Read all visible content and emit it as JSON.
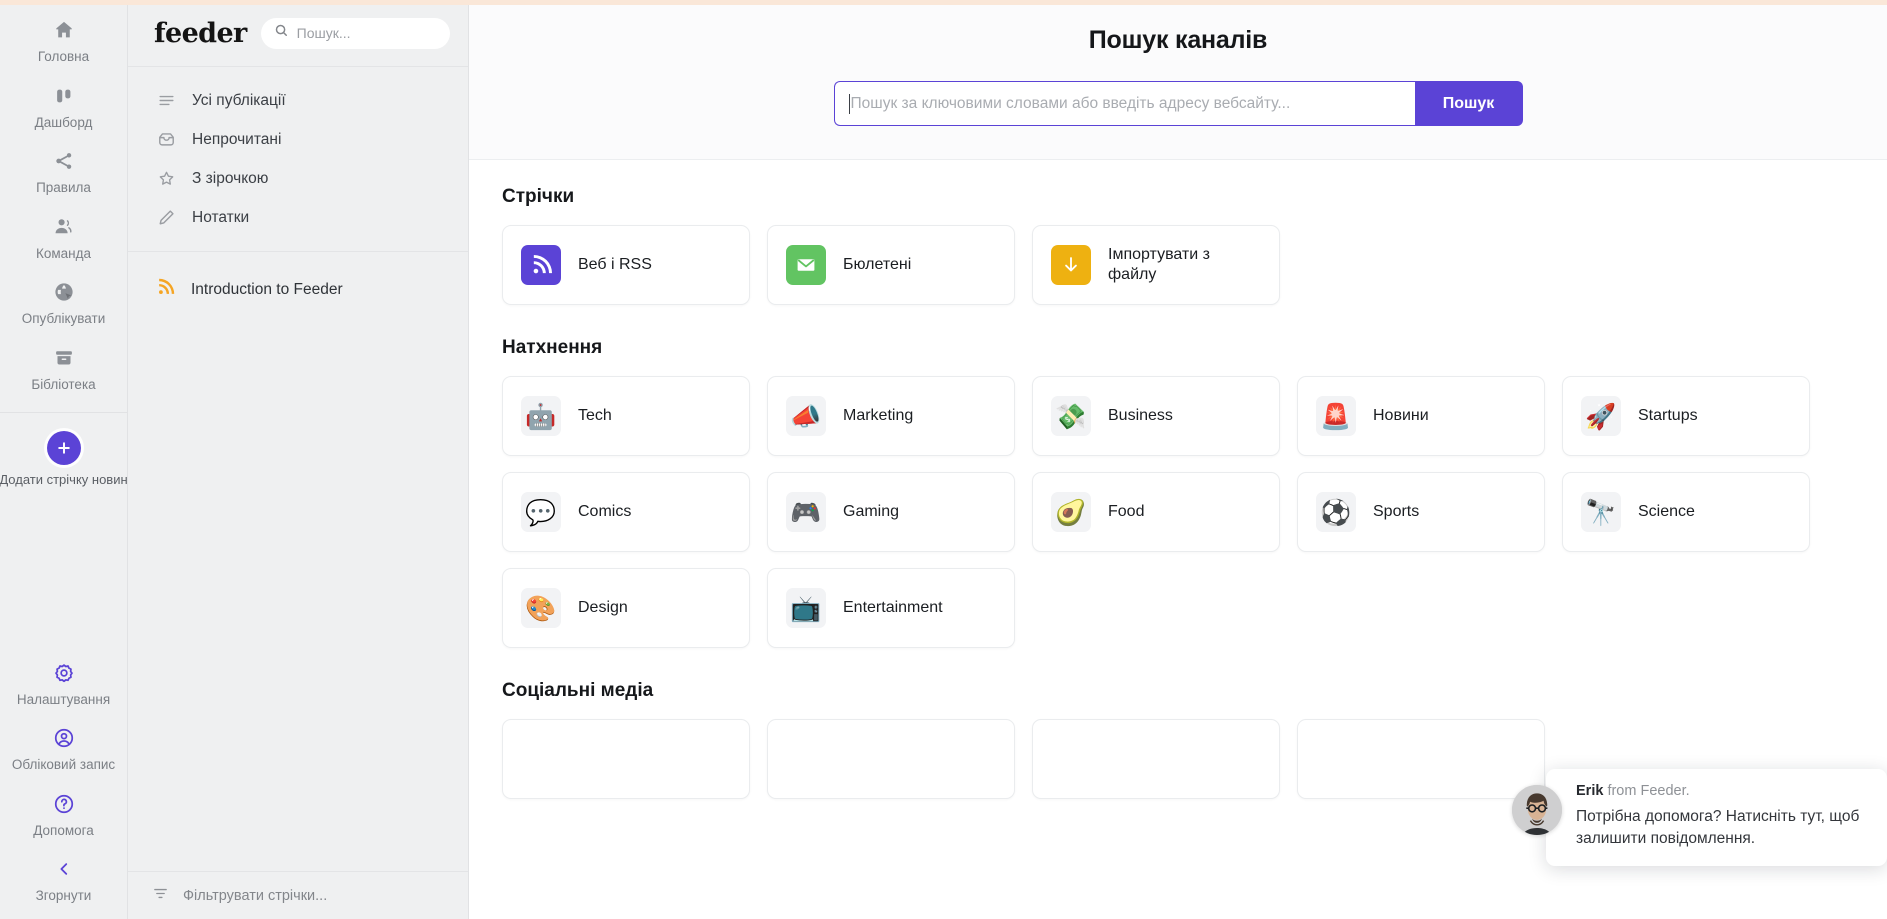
{
  "rail": {
    "items": [
      {
        "label": "Головна",
        "icon": "home-icon",
        "name": "home"
      },
      {
        "label": "Дашборд",
        "icon": "dashboard-icon",
        "name": "dashboard"
      },
      {
        "label": "Правила",
        "icon": "share-rules-icon",
        "name": "rules"
      },
      {
        "label": "Команда",
        "icon": "team-icon",
        "name": "team"
      },
      {
        "label": "Опублікувати",
        "icon": "publish-globe-icon",
        "name": "publish"
      },
      {
        "label": "Бібліотека",
        "icon": "library-archive-icon",
        "name": "library"
      }
    ],
    "add_feed": {
      "label": "Додати стрічку новин",
      "icon": "plus-icon"
    },
    "bottom_items": [
      {
        "label": "Налаштування",
        "icon": "gear-icon",
        "name": "settings"
      },
      {
        "label": "Обліковий запис",
        "icon": "account-circle-icon",
        "name": "account"
      },
      {
        "label": "Допомога",
        "icon": "help-question-icon",
        "name": "help"
      },
      {
        "label": "Згорнути",
        "icon": "chevron-left-icon",
        "name": "collapse"
      }
    ]
  },
  "panel": {
    "brand": "feeder",
    "search_placeholder": "Пошук...",
    "nav": [
      {
        "label": "Усі публікації",
        "icon": "list-lines-icon"
      },
      {
        "label": "Непрочитані",
        "icon": "inbox-icon"
      },
      {
        "label": "З зірочкою",
        "icon": "star-icon"
      },
      {
        "label": "Нотатки",
        "icon": "pencil-icon"
      }
    ],
    "feeds": [
      {
        "label": "Introduction to Feeder",
        "icon": "rss-icon"
      }
    ],
    "filter_placeholder": "Фільтрувати стрічки..."
  },
  "main": {
    "title": "Пошук каналів",
    "search_placeholder": "Пошук за ключовими словами або введіть адресу вебсайту...",
    "search_value": "",
    "search_button": "Пошук",
    "accent_color": "#5b43d6",
    "sections": [
      {
        "title": "Стрічки",
        "cards": [
          {
            "label": "Веб і RSS",
            "icon": "rss-icon",
            "style": "rss"
          },
          {
            "label": "Бюлетені",
            "icon": "envelope-icon",
            "style": "news"
          },
          {
            "label": "Імпортувати з файлу",
            "icon": "download-arrow-icon",
            "style": "import"
          }
        ]
      },
      {
        "title": "Натхнення",
        "cards": [
          {
            "label": "Tech",
            "icon": "robot-emoji",
            "glyph": "🤖",
            "style": "emoji"
          },
          {
            "label": "Marketing",
            "icon": "megaphone-emoji",
            "glyph": "📣",
            "style": "emoji"
          },
          {
            "label": "Business",
            "icon": "money-emoji",
            "glyph": "💸",
            "style": "emoji"
          },
          {
            "label": "Новини",
            "icon": "siren-emoji",
            "glyph": "🚨",
            "style": "emoji"
          },
          {
            "label": "Startups",
            "icon": "rocket-emoji",
            "glyph": "🚀",
            "style": "emoji"
          },
          {
            "label": "Comics",
            "icon": "speech-balloon-emoji",
            "glyph": "💬",
            "style": "emoji"
          },
          {
            "label": "Gaming",
            "icon": "gamepad-emoji",
            "glyph": "🎮",
            "style": "emoji"
          },
          {
            "label": "Food",
            "icon": "avocado-emoji",
            "glyph": "🥑",
            "style": "emoji"
          },
          {
            "label": "Sports",
            "icon": "soccer-ball-emoji",
            "glyph": "⚽",
            "style": "emoji"
          },
          {
            "label": "Science",
            "icon": "telescope-emoji",
            "glyph": "🔭",
            "style": "emoji"
          },
          {
            "label": "Design",
            "icon": "artist-palette-emoji",
            "glyph": "🎨",
            "style": "emoji"
          },
          {
            "label": "Entertainment",
            "icon": "clapper-tv-emoji",
            "glyph": "📺",
            "style": "emoji"
          }
        ]
      },
      {
        "title": "Соціальні медіа",
        "cards": []
      }
    ]
  },
  "chat": {
    "from_name": "Erik",
    "from_suffix": " from Feeder.",
    "message": "Потрібна допомога? Натисніть тут, щоб залишити повідомлення."
  }
}
